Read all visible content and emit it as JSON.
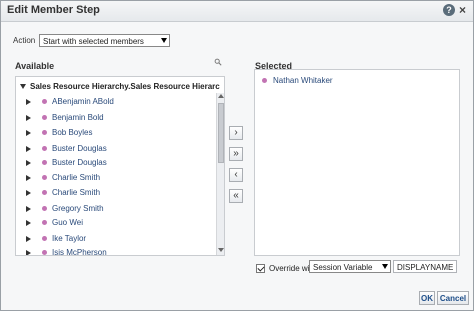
{
  "dialog": {
    "title": "Edit Member Step",
    "help_icon": "?",
    "close_icon": "×"
  },
  "action": {
    "label": "Action",
    "value": "Start with selected members"
  },
  "available": {
    "label": "Available",
    "hierarchy": "Sales Resource Hierarchy.Sales Resource Hierarc",
    "items": [
      {
        "label": "ABenjamin ABold"
      },
      {
        "label": "Benjamin Bold"
      },
      {
        "label": "Bob Boyles"
      },
      {
        "label": "Buster Douglas"
      },
      {
        "label": "Buster Douglas"
      },
      {
        "label": "Charlie Smith"
      },
      {
        "label": "Charlie Smith"
      },
      {
        "label": "Gregory Smith"
      },
      {
        "label": "Guo Wei"
      },
      {
        "label": "Ike Taylor"
      },
      {
        "label": "Isis McPherson"
      }
    ]
  },
  "move_buttons": [
    {
      "symbol": "›",
      "icon": "move-right-icon"
    },
    {
      "symbol": "»",
      "icon": "move-all-right-icon"
    },
    {
      "symbol": "‹",
      "icon": "move-left-icon"
    },
    {
      "symbol": "«",
      "icon": "move-all-left-icon"
    }
  ],
  "selected": {
    "label": "Selected",
    "items": [
      {
        "label": "Nathan Whitaker"
      }
    ]
  },
  "override": {
    "label": "Override with",
    "checked": true,
    "select_value": "Session Variable",
    "field_value": "DISPLAYNAME"
  },
  "buttons": {
    "ok": "OK",
    "cancel": "Cancel"
  },
  "colors": {
    "accent": "#1f4f8a",
    "member_dot": "#c273b3",
    "link": "#2a4a7a"
  }
}
